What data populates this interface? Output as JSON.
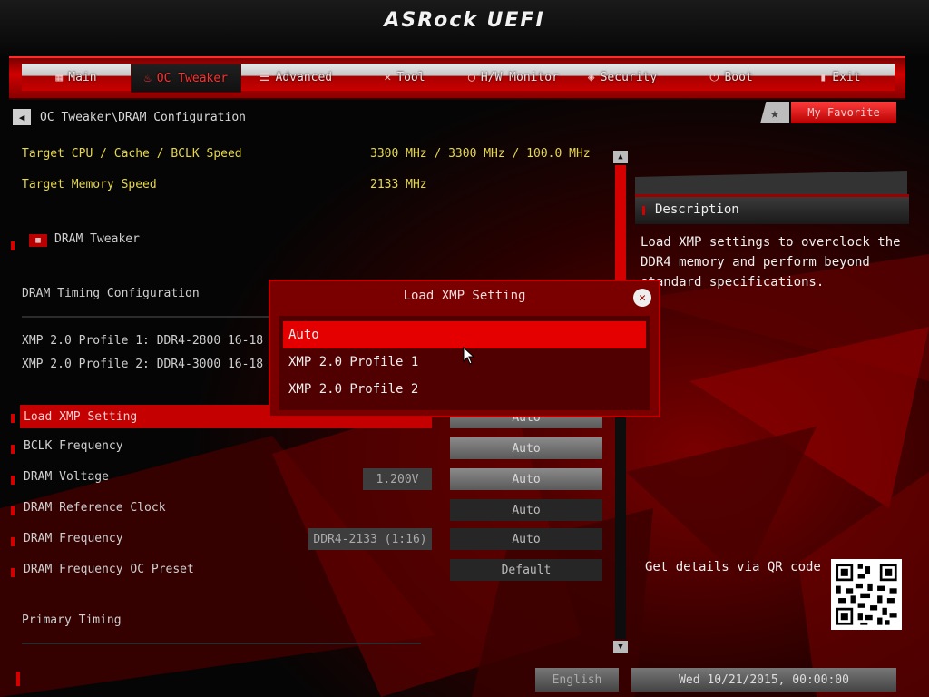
{
  "header": {
    "brand": "ASRock UEFI"
  },
  "tabs": [
    {
      "label": "Main",
      "icon": "grid-icon"
    },
    {
      "label": "OC Tweaker",
      "icon": "flame-icon",
      "active": true
    },
    {
      "label": "Advanced",
      "icon": "list-icon"
    },
    {
      "label": "Tool",
      "icon": "wrench-icon"
    },
    {
      "label": "H/W Monitor",
      "icon": "monitor-icon"
    },
    {
      "label": "Security",
      "icon": "shield-icon"
    },
    {
      "label": "Boot",
      "icon": "power-icon"
    },
    {
      "label": "Exit",
      "icon": "door-icon"
    }
  ],
  "breadcrumb": "OC Tweaker\\DRAM Configuration",
  "favorite": {
    "label": "My Favorite"
  },
  "info": {
    "target_cpu_label": "Target CPU / Cache / BCLK Speed",
    "target_cpu_value": "3300 MHz / 3300 MHz / 100.0 MHz",
    "target_mem_label": "Target Memory Speed",
    "target_mem_value": "2133 MHz"
  },
  "sections": {
    "dram_tweaker": "DRAM Tweaker",
    "timing_config": "DRAM Timing Configuration",
    "xmp1": "XMP 2.0 Profile 1: DDR4-2800 16-18",
    "xmp2": "XMP 2.0 Profile 2: DDR4-3000 16-18",
    "primary_timing": "Primary Timing"
  },
  "settings": [
    {
      "label": "Load XMP Setting",
      "value": "Auto",
      "current": "",
      "highlight": true
    },
    {
      "label": "BCLK Frequency",
      "value": "Auto",
      "current": ""
    },
    {
      "label": "DRAM Voltage",
      "value": "Auto",
      "current": "1.200V"
    },
    {
      "label": "DRAM Reference Clock",
      "value": "Auto",
      "current": ""
    },
    {
      "label": "DRAM Frequency",
      "value": "Auto",
      "current": "DDR4-2133 (1:16)"
    },
    {
      "label": "DRAM Frequency OC Preset",
      "value": "Default",
      "current": ""
    }
  ],
  "description": {
    "title": "Description",
    "text": "Load XMP settings to overclock the DDR4 memory and perform beyond standard specifications.",
    "qr_label": "Get details via QR code"
  },
  "footer": {
    "language": "English",
    "datetime": "Wed 10/21/2015, 00:00:00"
  },
  "modal": {
    "title": "Load XMP Setting",
    "options": [
      "Auto",
      "XMP 2.0 Profile 1",
      "XMP 2.0 Profile 2"
    ],
    "selected": "Auto"
  },
  "colors": {
    "accent": "#d40000",
    "info_text": "#e6d84a",
    "modal_bg": "#7a0000"
  }
}
